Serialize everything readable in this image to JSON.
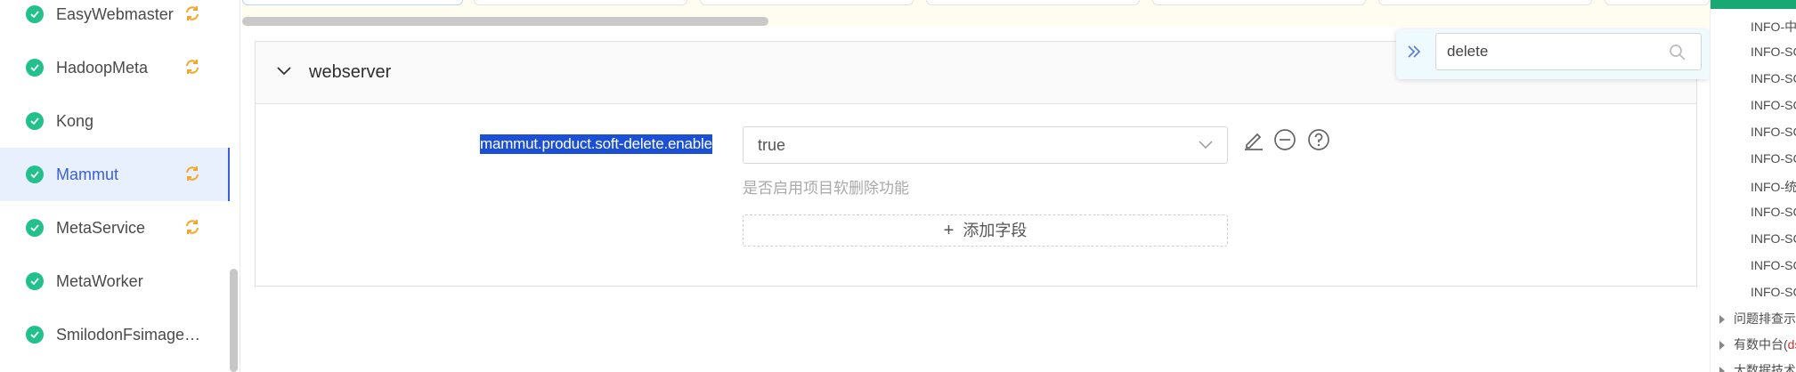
{
  "sidebar": {
    "services": [
      {
        "name": "EasyWebmaster",
        "syncing": true,
        "active": false
      },
      {
        "name": "HadoopMeta",
        "syncing": true,
        "active": false
      },
      {
        "name": "Kong",
        "syncing": false,
        "active": false
      },
      {
        "name": "Mammut",
        "syncing": true,
        "active": true
      },
      {
        "name": "MetaService",
        "syncing": true,
        "active": false
      },
      {
        "name": "MetaWorker",
        "syncing": false,
        "active": false
      },
      {
        "name": "SmilodonFsimage…",
        "syncing": false,
        "active": false
      }
    ]
  },
  "config_panel": {
    "section_title": "webserver",
    "key": "mammut.product.soft-delete.enable",
    "value": "true",
    "description": "是否启用项目软删除功能",
    "add_field_label": "添加字段",
    "add_field_icon": "+"
  },
  "search": {
    "value": "delete"
  },
  "log_panel": {
    "lines": [
      "INFO-中",
      "INFO-SC",
      "INFO-SC",
      "INFO-SC",
      "INFO-SC",
      "INFO-SC",
      "INFO-统",
      "INFO-SC",
      "INFO-SC",
      "INFO-SC",
      "INFO-SC"
    ],
    "tree_items": [
      {
        "label": "问题排查示",
        "suffix": ""
      },
      {
        "label": "有数中台(",
        "suffix": "ds"
      },
      {
        "label": "大数据技术",
        "suffix": ""
      }
    ]
  },
  "colors": {
    "accent": "#3b5fd9",
    "success": "#22c08a",
    "sync": "#f5a623",
    "selection": "#1a4fd6"
  }
}
